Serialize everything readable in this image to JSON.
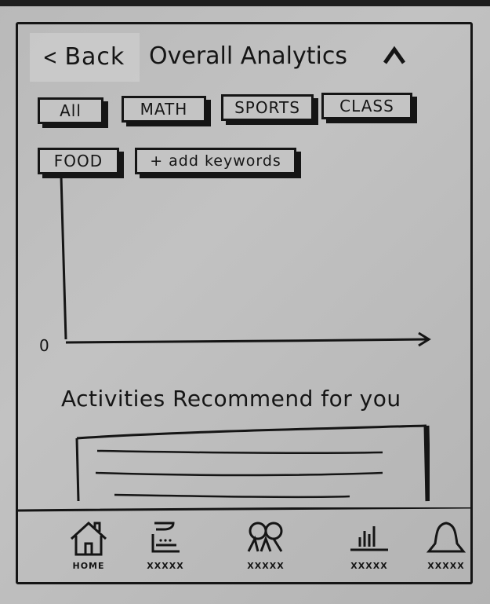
{
  "header": {
    "back_label": "Back",
    "title": "Overall Analytics",
    "collapse_icon": "caret-up-icon"
  },
  "filters": {
    "chips": [
      "All",
      "MATH",
      "SPORTS",
      "CLASS",
      "FOOD"
    ],
    "add_label": "+ add keywords"
  },
  "chart": {
    "origin_label": "0"
  },
  "recommendations": {
    "title": "Activities Recommend for you"
  },
  "tabbar": {
    "items": [
      {
        "label": "HOME",
        "icon": "home-icon"
      },
      {
        "label": "XXXXX",
        "icon": "inbox-icon"
      },
      {
        "label": "XXXXX",
        "icon": "people-icon"
      },
      {
        "label": "XXXXX",
        "icon": "analytics-icon"
      },
      {
        "label": "XXXXX",
        "icon": "bell-icon"
      }
    ]
  }
}
